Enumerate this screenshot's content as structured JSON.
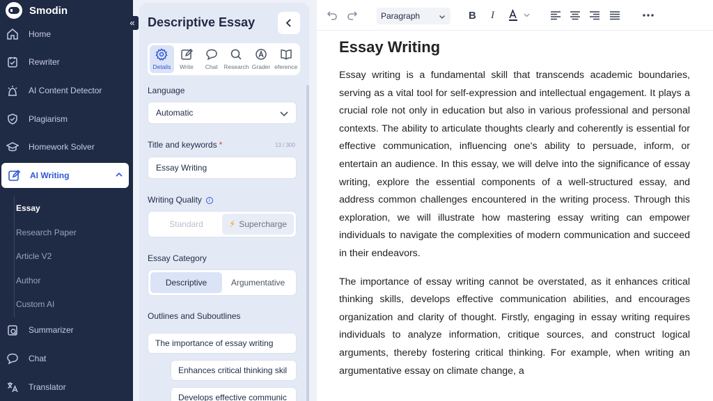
{
  "brand": {
    "name": "Smodin"
  },
  "sidebar": {
    "items": [
      {
        "label": "Home",
        "icon": "home-icon"
      },
      {
        "label": "Rewriter",
        "icon": "rewriter-icon"
      },
      {
        "label": "AI Content Detector",
        "icon": "detector-icon"
      },
      {
        "label": "Plagiarism",
        "icon": "shield-check-icon"
      },
      {
        "label": "Homework Solver",
        "icon": "graduation-cap-icon"
      },
      {
        "label": "AI Writing",
        "icon": "pencil-square-icon"
      },
      {
        "label": "Summarizer",
        "icon": "summarizer-icon"
      },
      {
        "label": "Chat",
        "icon": "chat-bubble-icon"
      },
      {
        "label": "Translator",
        "icon": "translate-icon"
      }
    ],
    "sub_items": [
      "Essay",
      "Research Paper",
      "Article V2",
      "Author",
      "Custom AI"
    ]
  },
  "panel": {
    "title": "Descriptive Essay",
    "tabs": [
      "Details",
      "Write",
      "Chat",
      "Research",
      "Grader",
      "eference"
    ],
    "language_label": "Language",
    "language_value": "Automatic",
    "title_keywords_label": "Title and keywords",
    "required_mark": "*",
    "title_counter": "13 / 300",
    "title_value": "Essay Writing",
    "quality_label": "Writing Quality",
    "quality_options": [
      "Standard",
      "Supercharge"
    ],
    "category_label": "Essay Category",
    "category_options": [
      "Descriptive",
      "Argumentative"
    ],
    "outlines_label": "Outlines and Suboutlines",
    "outlines": [
      "The importance of essay writing",
      "Enhances critical thinking skil",
      "Develops effective communic"
    ]
  },
  "editor": {
    "paragraph_style": "Paragraph",
    "title": "Essay Writing",
    "paragraphs": [
      "Essay writing is a fundamental skill that transcends academic boundaries, serving as a vital tool for self-expression and intellectual engagement. It plays a crucial role not only in education but also in various professional and personal contexts. The ability to articulate thoughts clearly and coherently is essential for effective communication, influencing one's ability to persuade, inform, or entertain an audience. In this essay, we will delve into the significance of essay writing, explore the essential components of a well-structured essay, and address common challenges encountered in the writing process. Through this exploration, we will illustrate how mastering essay writing can empower individuals to navigate the complexities of modern communication and succeed in their endeavors.",
      "The importance of essay writing cannot be overstated, as it enhances critical thinking skills, develops effective communication abilities, and encourages organization and clarity of thought. Firstly, engaging in essay writing requires individuals to analyze information, critique sources, and construct logical arguments, thereby fostering critical thinking. For example, when writing an argumentative essay on climate change, a"
    ]
  },
  "colors": {
    "sidebar_bg": "#1f2a44",
    "accent": "#3057d6",
    "panel_bg": "#e4e9f6"
  }
}
